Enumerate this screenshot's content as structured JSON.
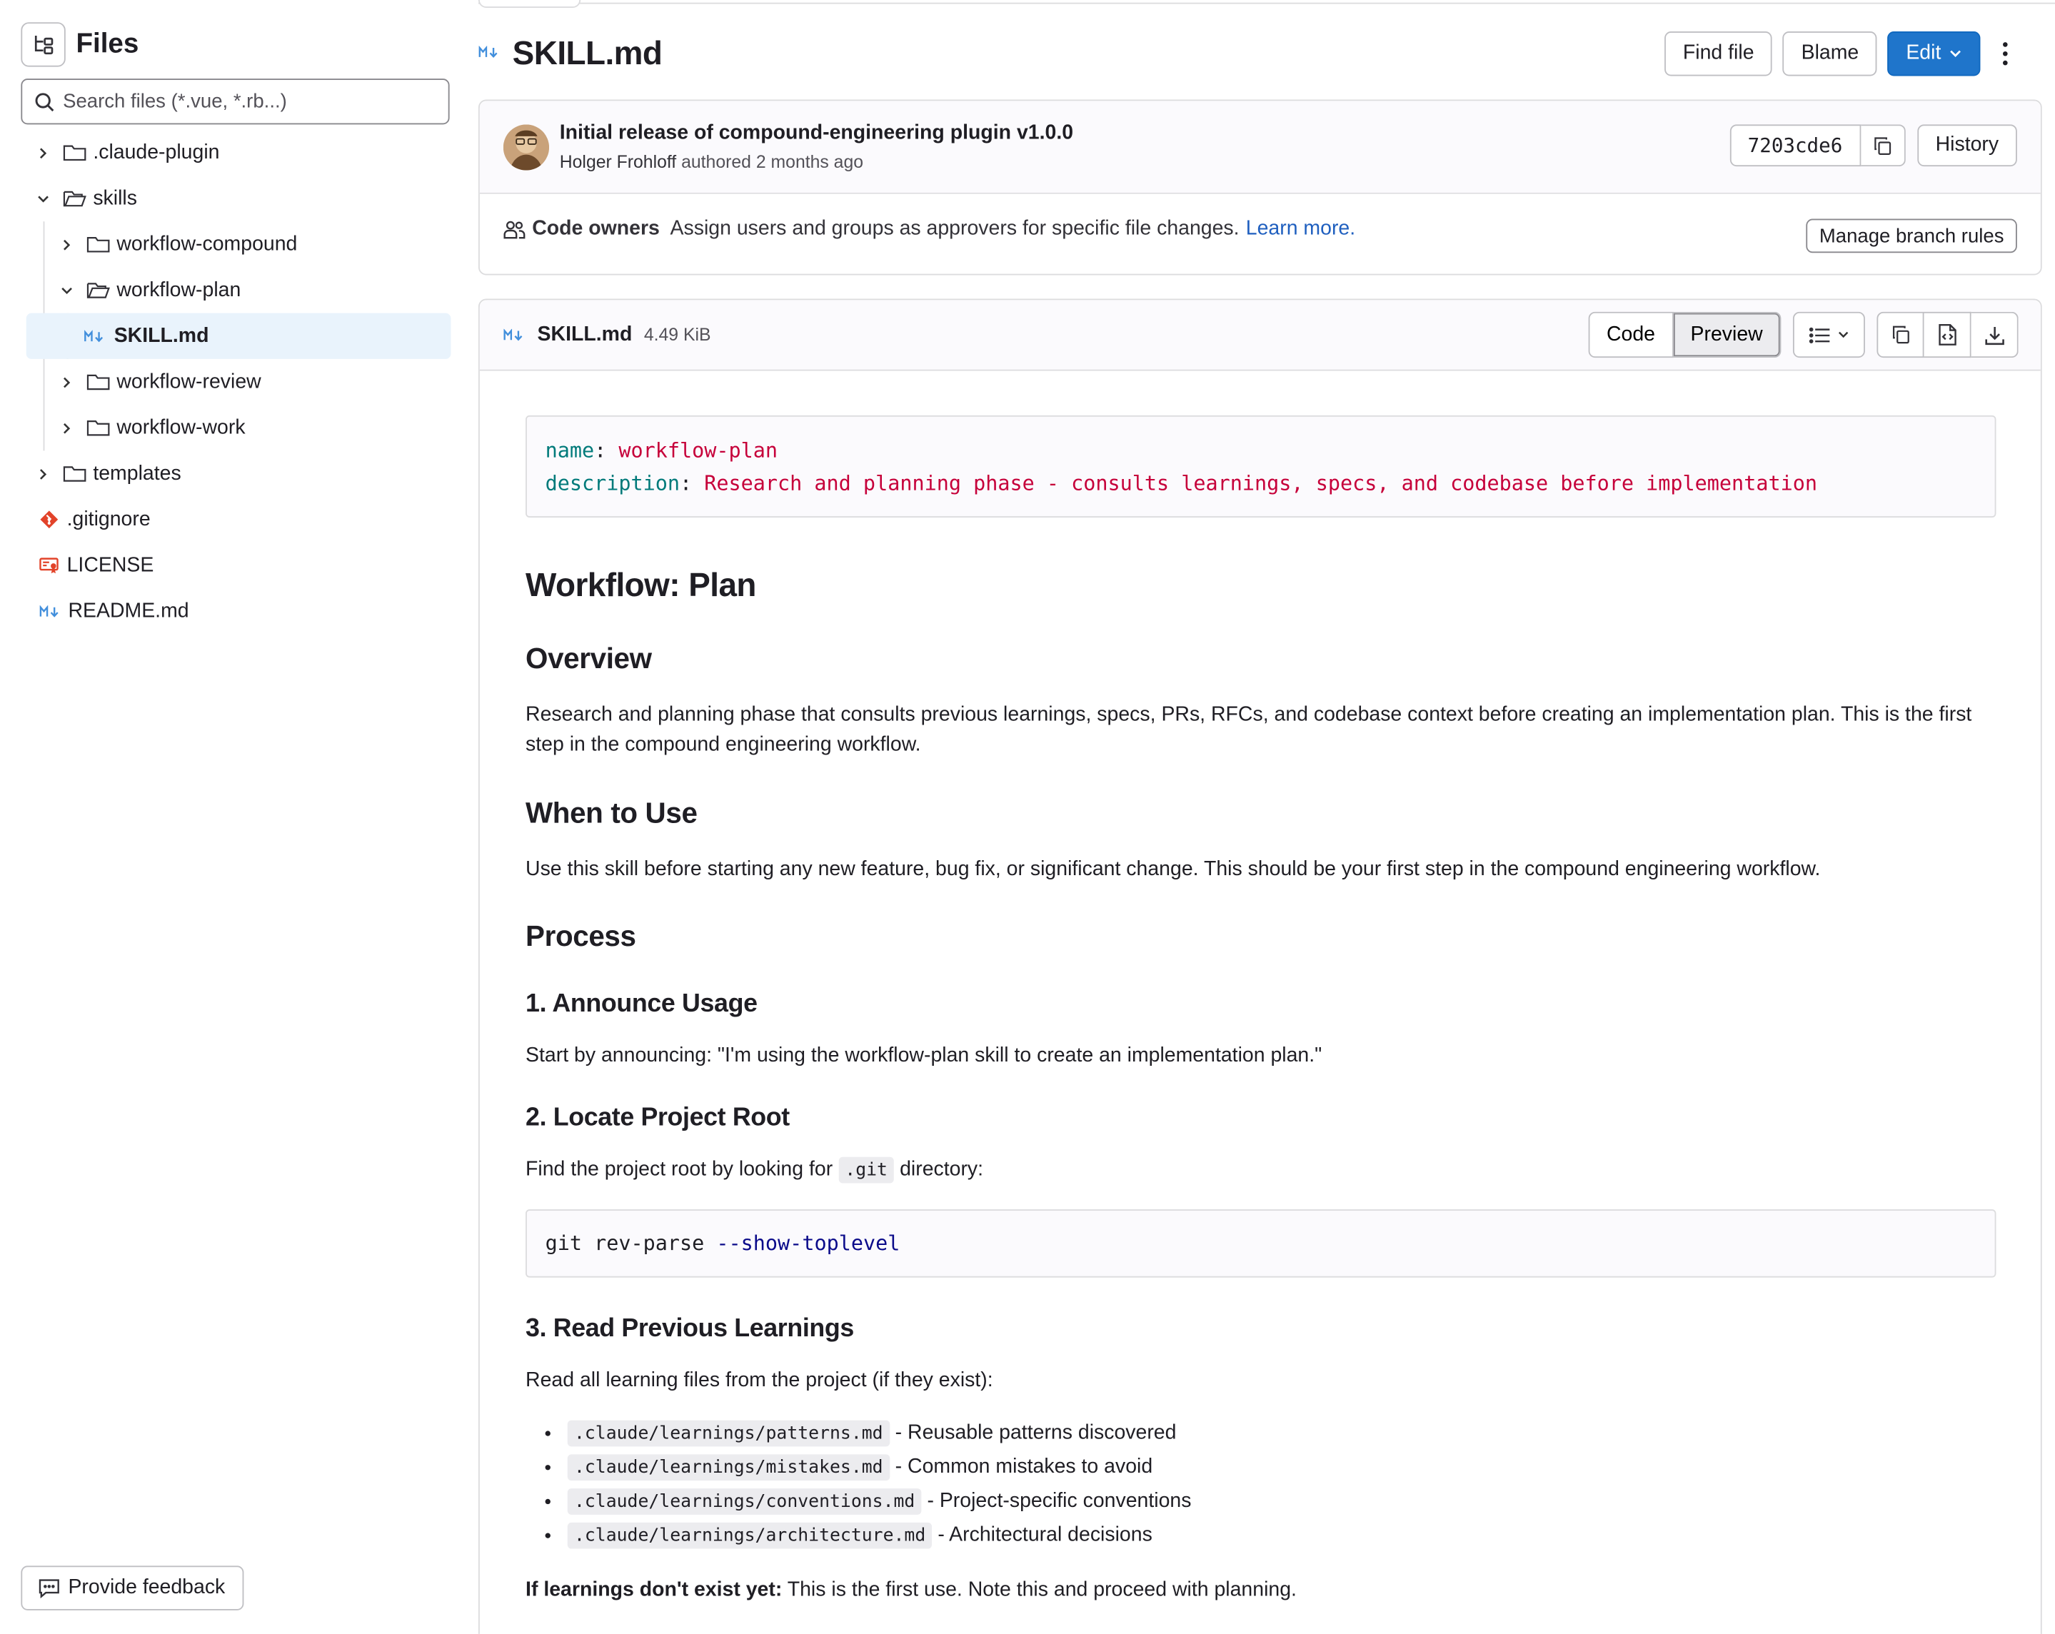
{
  "sidebar": {
    "title": "Files",
    "search_placeholder": "Search files (*.vue, *.rb...)",
    "tree": [
      {
        "label": ".claude-plugin",
        "type": "folder",
        "expanded": false,
        "depth": 0
      },
      {
        "label": "skills",
        "type": "folder",
        "expanded": true,
        "depth": 0
      },
      {
        "label": "workflow-compound",
        "type": "folder",
        "expanded": false,
        "depth": 1
      },
      {
        "label": "workflow-plan",
        "type": "folder",
        "expanded": true,
        "depth": 1
      },
      {
        "label": "SKILL.md",
        "type": "markdown",
        "depth": 2,
        "active": true
      },
      {
        "label": "workflow-review",
        "type": "folder",
        "expanded": false,
        "depth": 1
      },
      {
        "label": "workflow-work",
        "type": "folder",
        "expanded": false,
        "depth": 1
      },
      {
        "label": "templates",
        "type": "folder",
        "expanded": false,
        "depth": 0
      },
      {
        "label": ".gitignore",
        "type": "git",
        "depth": 0
      },
      {
        "label": "LICENSE",
        "type": "license",
        "depth": 0
      },
      {
        "label": "README.md",
        "type": "markdown",
        "depth": 0
      }
    ],
    "feedback_label": "Provide feedback"
  },
  "header": {
    "file_title": "SKILL.md",
    "find_file": "Find file",
    "blame": "Blame",
    "edit": "Edit"
  },
  "commit": {
    "message": "Initial release of compound-engineering plugin v1.0.0",
    "author": "Holger Frohloff",
    "authored_text": "authored",
    "time": "2 months ago",
    "sha": "7203cde6",
    "history": "History"
  },
  "code_owners": {
    "label": "Code owners",
    "text": "Assign users and groups as approvers for specific file changes.",
    "link": "Learn more.",
    "manage": "Manage branch rules"
  },
  "file": {
    "name": "SKILL.md",
    "size": "4.49 KiB",
    "code_tab": "Code",
    "preview_tab": "Preview"
  },
  "doc": {
    "fm_name_key": "name",
    "fm_name_val": "workflow-plan",
    "fm_desc_key": "description",
    "fm_desc_val": "Research and planning phase - consults learnings, specs, and codebase before implementation",
    "h1": "Workflow: Plan",
    "overview_h": "Overview",
    "overview_p": "Research and planning phase that consults previous learnings, specs, PRs, RFCs, and codebase context before creating an implementation plan. This is the first step in the compound engineering workflow.",
    "when_h": "When to Use",
    "when_p": "Use this skill before starting any new feature, bug fix, or significant change. This should be your first step in the compound engineering workflow.",
    "process_h": "Process",
    "step1_h": "1. Announce Usage",
    "step1_p": "Start by announcing: \"I'm using the workflow-plan skill to create an implementation plan.\"",
    "step2_h": "2. Locate Project Root",
    "step2_p_pre": "Find the project root by looking for",
    "step2_code": ".git",
    "step2_p_post": "directory:",
    "code_cmd": "git rev-parse",
    "code_opt": "--show-toplevel",
    "step3_h": "3. Read Previous Learnings",
    "step3_p": "Read all learning files from the project (if they exist):",
    "learnings": [
      {
        "path": ".claude/learnings/patterns.md",
        "desc": "- Reusable patterns discovered"
      },
      {
        "path": ".claude/learnings/mistakes.md",
        "desc": "- Common mistakes to avoid"
      },
      {
        "path": ".claude/learnings/conventions.md",
        "desc": "- Project-specific conventions"
      },
      {
        "path": ".claude/learnings/architecture.md",
        "desc": "- Architectural decisions"
      }
    ],
    "note_bold": "If learnings don't exist yet:",
    "note_text": "This is the first use. Note this and proceed with planning."
  },
  "colors": {
    "primary": "#1f75cb",
    "link": "#1f5fbf",
    "active_row": "#e9f3fc",
    "fm_key": "#007a7a",
    "fm_val": "#c6003a"
  }
}
